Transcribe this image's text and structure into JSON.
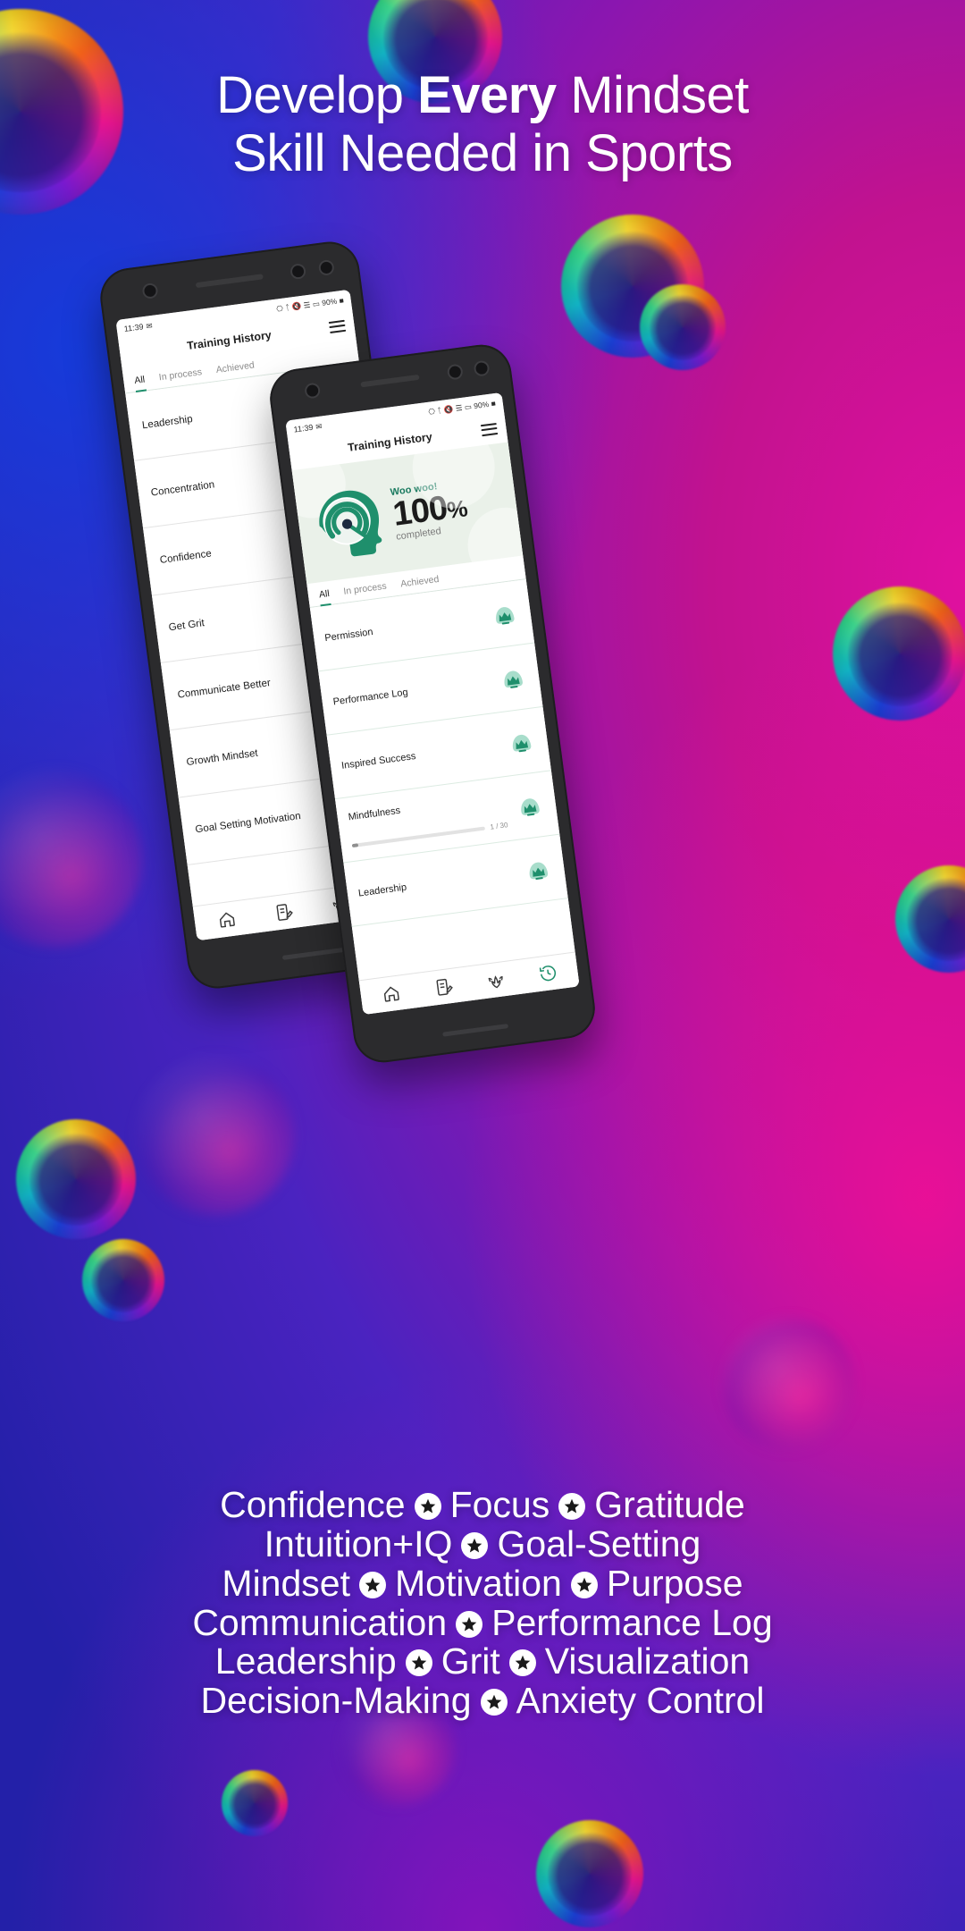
{
  "headline": {
    "line1_plain": "Develop ",
    "line1_bold": "Every",
    "line1_tail": " Mindset",
    "line2": "Skill Needed in Sports"
  },
  "phone_back": {
    "status": {
      "time": "11:39",
      "msg_icon": "message-icon",
      "nfc_icon": "nfc-icon",
      "bluetooth_icon": "bluetooth-icon",
      "mute_icon": "mute-icon",
      "wifi_icon": "wifi-icon",
      "signal_icon": "signal-icon",
      "battery_pct": "90%",
      "battery_icon": "battery-icon"
    },
    "appbar": {
      "title": "Training History",
      "menu_icon": "hamburger-menu-icon"
    },
    "tabs": [
      {
        "label": "All",
        "active": true
      },
      {
        "label": "In process",
        "active": false
      },
      {
        "label": "Achieved",
        "active": false
      }
    ],
    "rows": [
      {
        "name": "Leadership"
      },
      {
        "name": "Concentration"
      },
      {
        "name": "Confidence"
      },
      {
        "name": "Get Grit"
      },
      {
        "name": "Communicate Better"
      },
      {
        "name": "Growth Mindset"
      },
      {
        "name": "Goal Setting Motivation"
      }
    ],
    "nav": [
      {
        "icon": "home-icon"
      },
      {
        "icon": "notes-icon"
      },
      {
        "icon": "meditation-icon"
      },
      {
        "icon": "history-icon"
      }
    ]
  },
  "phone_front": {
    "status": {
      "time": "11:39",
      "msg_icon": "message-icon",
      "nfc_icon": "nfc-icon",
      "bluetooth_icon": "bluetooth-icon",
      "mute_icon": "mute-icon",
      "wifi_icon": "wifi-icon",
      "signal_icon": "signal-icon",
      "battery_pct": "90%",
      "battery_icon": "battery-icon"
    },
    "appbar": {
      "title": "Training History",
      "menu_icon": "hamburger-menu-icon"
    },
    "hero": {
      "gauge_icon": "head-gauge-icon",
      "woo": "Woo woo!",
      "percent": "100",
      "percent_sign": "%",
      "completed": "completed"
    },
    "tabs": [
      {
        "label": "All",
        "active": true
      },
      {
        "label": "In process",
        "active": false
      },
      {
        "label": "Achieved",
        "active": false
      }
    ],
    "rows": [
      {
        "name": "Permission",
        "badge": "crown-icon",
        "progress": null
      },
      {
        "name": "Performance Log",
        "badge": "crown-icon",
        "progress": null
      },
      {
        "name": "Inspired Success",
        "badge": "crown-icon",
        "progress": null
      },
      {
        "name": "Mindfulness",
        "badge": "crown-icon",
        "progress": "1 / 30",
        "percent": 5
      },
      {
        "name": "Leadership",
        "badge": "crown-icon",
        "progress": null
      }
    ],
    "nav": [
      {
        "icon": "home-icon"
      },
      {
        "icon": "notes-icon"
      },
      {
        "icon": "meditation-icon"
      },
      {
        "icon": "history-icon"
      }
    ]
  },
  "keywords": {
    "lines": [
      [
        "Confidence",
        "Focus",
        "Gratitude"
      ],
      [
        "Intuition+IQ",
        "Goal-Setting"
      ],
      [
        "Mindset",
        "Motivation",
        "Purpose"
      ],
      [
        "Communication",
        "Performance Log"
      ],
      [
        "Leadership",
        "Grit",
        "Visualization"
      ],
      [
        "Decision-Making",
        "Anxiety Control"
      ]
    ],
    "separator_icon": "star-badge-icon"
  },
  "colors": {
    "brand_green": "#1f8f6c",
    "hero_bg": "#eaf1e9",
    "text_dark": "#1b1b1b",
    "text_muted": "#8d8d8d"
  }
}
